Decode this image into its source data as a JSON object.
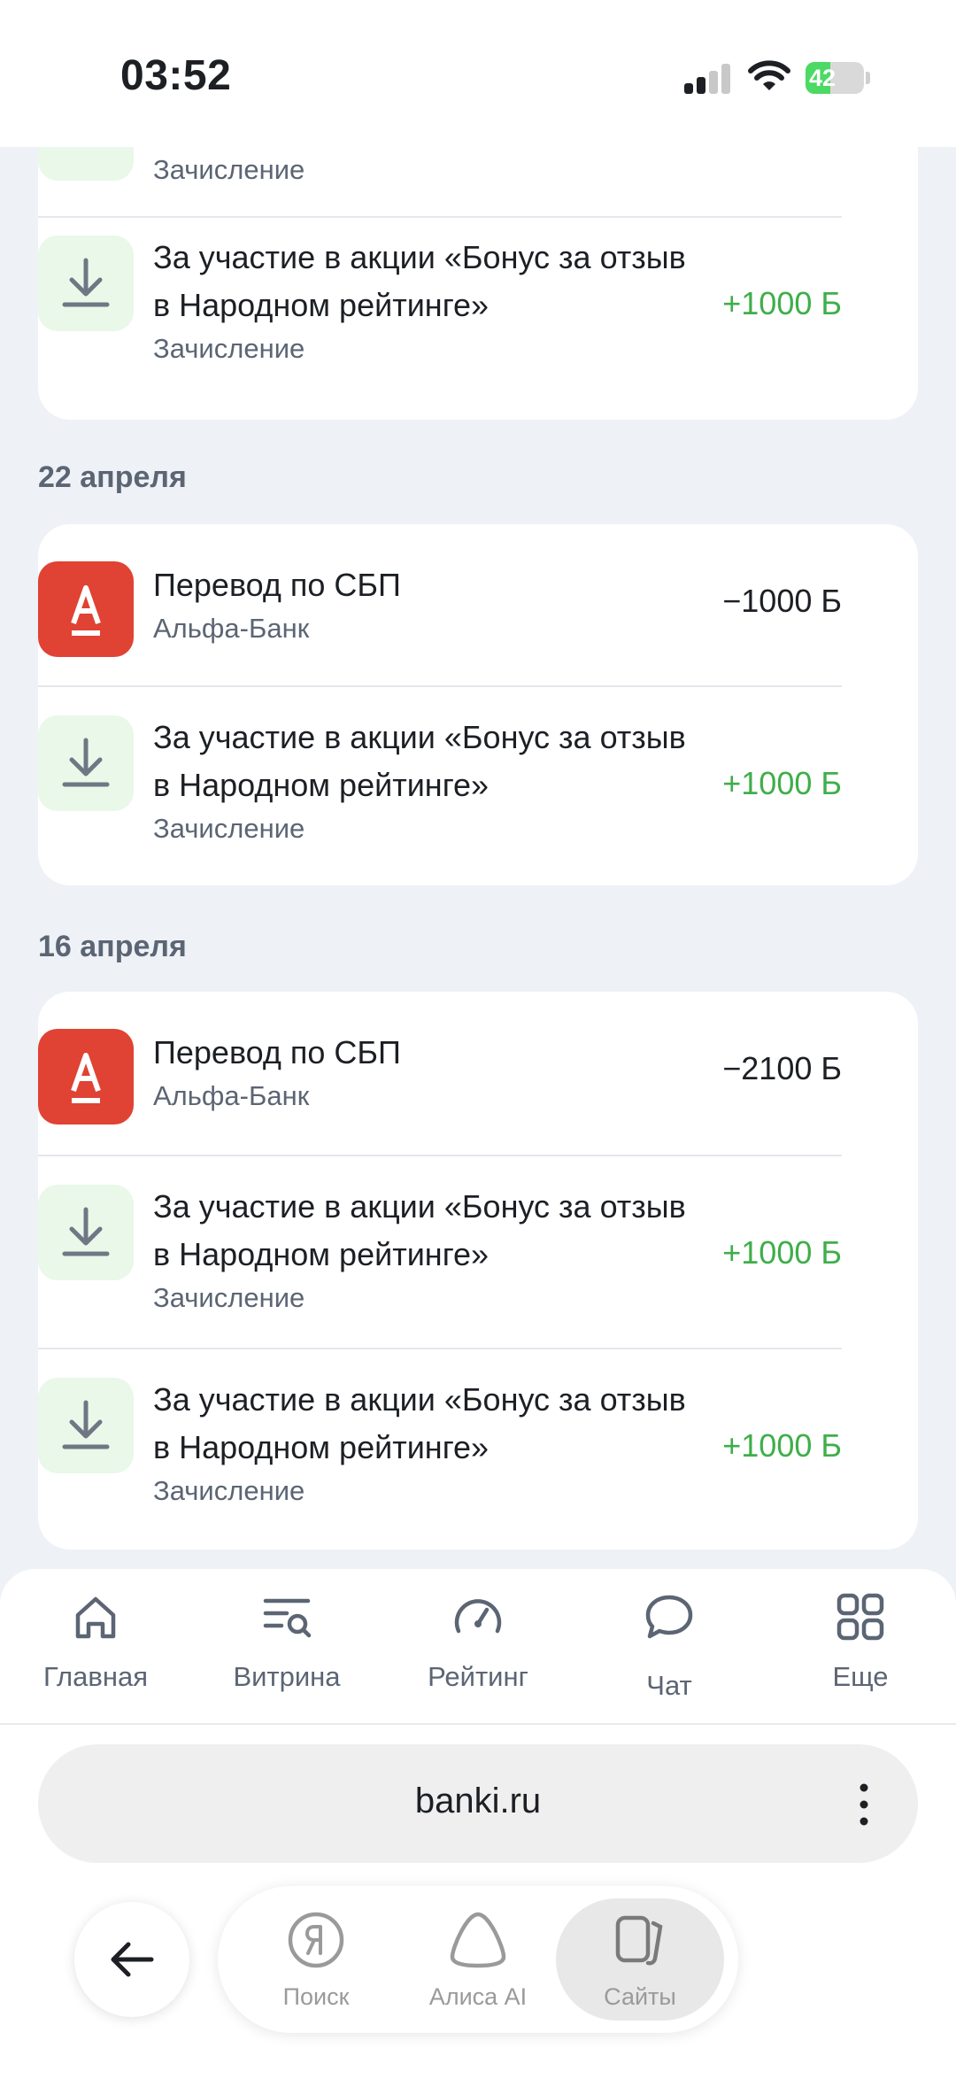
{
  "status_bar": {
    "time": "03:52",
    "battery_percent": "42",
    "battery_level": 0.42
  },
  "feed": {
    "top_partial": {
      "subtitle": "Зачисление"
    },
    "top_item": {
      "title": "За участие в акции «Бонус за отзыв в Народном рейтинге»",
      "subtitle": "Зачисление",
      "amount": "+1000 Б"
    },
    "groups": [
      {
        "date": "22 апреля",
        "items": [
          {
            "kind": "transfer",
            "title": "Перевод по СБП",
            "subtitle": "Альфа-Банк",
            "amount": "−1000 Б"
          },
          {
            "kind": "bonus",
            "title": "За участие в акции «Бонус за отзыв в Народном рейтинге»",
            "subtitle": "Зачисление",
            "amount": "+1000 Б"
          }
        ]
      },
      {
        "date": "16 апреля",
        "items": [
          {
            "kind": "transfer",
            "title": "Перевод по СБП",
            "subtitle": "Альфа-Банк",
            "amount": "−2100 Б"
          },
          {
            "kind": "bonus",
            "title": "За участие в акции «Бонус за отзыв в Народном рейтинге»",
            "subtitle": "Зачисление",
            "amount": "+1000 Б"
          },
          {
            "kind": "bonus",
            "title": "За участие в акции «Бонус за отзыв в Народном рейтинге»",
            "subtitle": "Зачисление",
            "amount": "+1000 Б"
          }
        ]
      }
    ]
  },
  "tab_bar": {
    "items": [
      {
        "label": "Главная",
        "icon": "home-icon"
      },
      {
        "label": "Витрина",
        "icon": "showcase-search-icon"
      },
      {
        "label": "Рейтинг",
        "icon": "speedometer-icon"
      },
      {
        "label": "Чат",
        "icon": "chat-bubble-icon"
      },
      {
        "label": "Еще",
        "icon": "grid-icon"
      }
    ]
  },
  "browser": {
    "url": "banki.ru",
    "nav": [
      {
        "label": "Поиск",
        "icon": "yandex-search-icon"
      },
      {
        "label": "Алиса AI",
        "icon": "alice-icon"
      },
      {
        "label": "Сайты",
        "icon": "tabs-icon",
        "active": true
      }
    ]
  },
  "colors": {
    "accent_green": "#3fae4a",
    "alfa_red": "#e04233",
    "bonus_bg": "#e9f8e8"
  }
}
